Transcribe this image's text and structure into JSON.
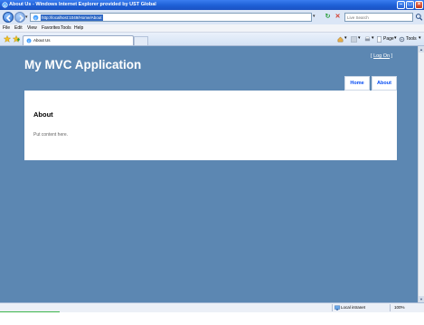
{
  "browser": {
    "window_title": "About Us - Windows Internet Explorer provided by UST Global",
    "address_url": "http://localhost:1049/Home/About",
    "search_placeholder": "Live Search",
    "menu": [
      "File",
      "Edit",
      "View",
      "Favorites",
      "Tools",
      "Help"
    ],
    "tab_title": "About Us",
    "commands": {
      "page": "Page",
      "tools": "Tools"
    },
    "status": {
      "zone": "Local intranet",
      "zoom": "100%",
      "progress": 0.14
    }
  },
  "site": {
    "title": "My MVC Application",
    "login": {
      "open": "[",
      "link": "Log On",
      "close": "]"
    },
    "menu": [
      {
        "label": "Home"
      },
      {
        "label": "About"
      }
    ],
    "main": {
      "heading": "About",
      "body": "Put content here."
    }
  },
  "colors": {
    "page_bg": "#5c87b2",
    "menu_text": "#034af3",
    "titlebar": "#1e5fd6"
  }
}
